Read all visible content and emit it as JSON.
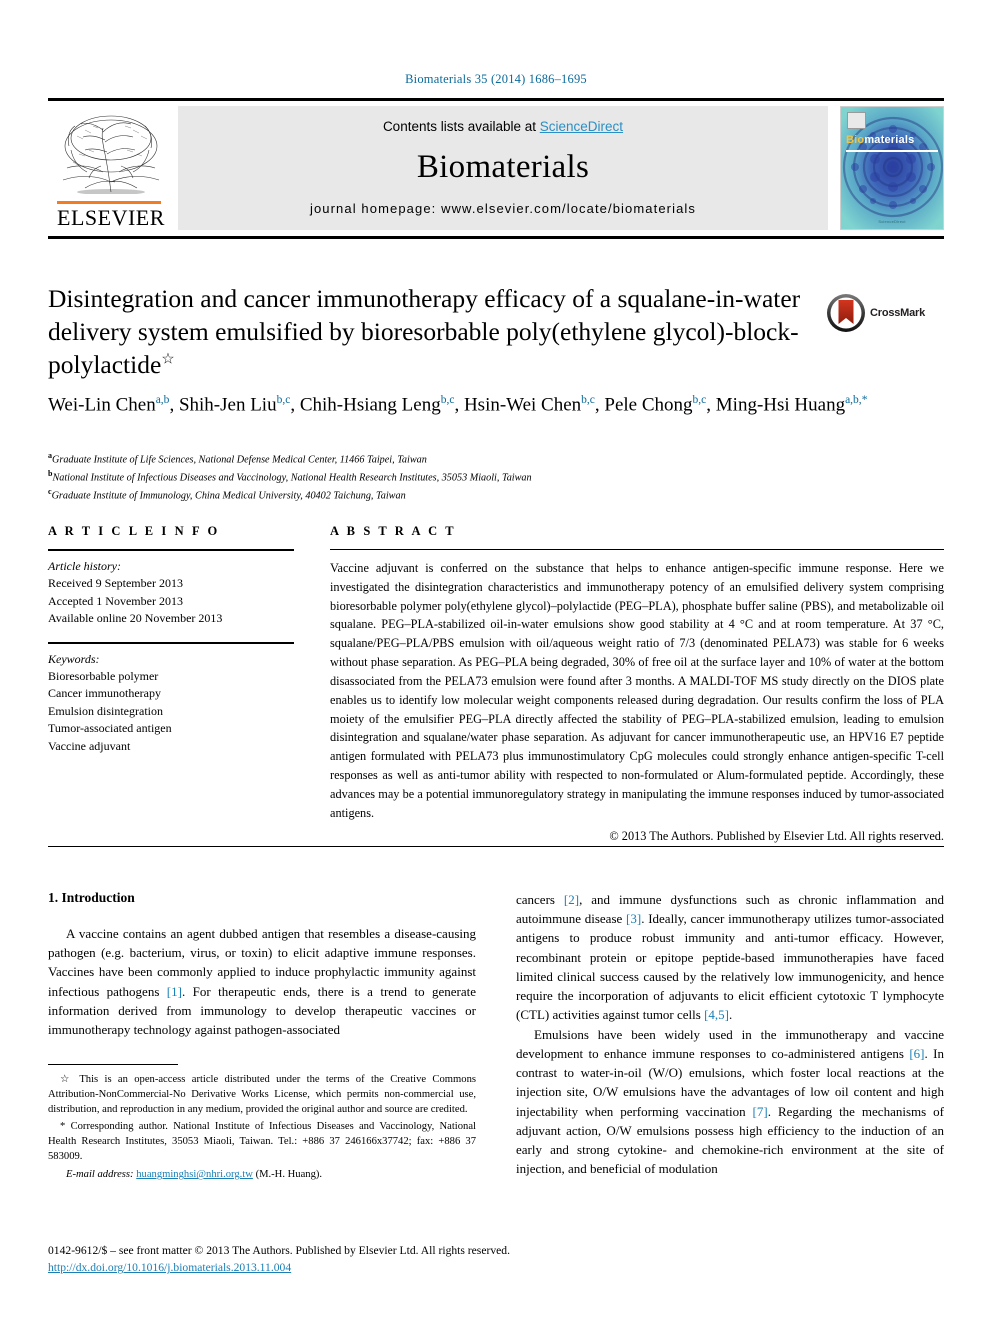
{
  "running_head": "Biomaterials 35 (2014) 1686–1695",
  "journal_header": {
    "contents_prefix": "Contents lists available at ",
    "sciencedirect": "ScienceDirect",
    "journal_title": "Biomaterials",
    "homepage": "journal homepage: www.elsevier.com/locate/biomaterials",
    "publisher": "ELSEVIER",
    "cover": {
      "title_bio": "Bio",
      "title_rest": "materials",
      "footer": "ScienceDirect"
    },
    "accent_orange": "#F47B20",
    "accent_blue": "#2a8fc4",
    "band_gray": "#e8e8e8",
    "cover_teal": "#5ec8c8"
  },
  "article": {
    "title": "Disintegration and cancer immunotherapy efficacy of a squalane-in-water delivery system emulsified by bioresorbable poly(ethylene glycol)-block-polylactide",
    "title_footnote_mark": "☆",
    "crossmark_label": "CrossMark",
    "authors_html": "Wei-Lin Chen<sup>a,b</sup>, Shih-Jen Liu<sup>b,c</sup>, Chih-Hsiang Leng<sup>b,c</sup>, Hsin-Wei Chen<sup>b,c</sup>, Pele Chong<sup>b,c</sup>, Ming-Hsi Huang<sup>a,b,</sup><sup>*</sup>",
    "affiliations": [
      {
        "mark": "a",
        "text": "Graduate Institute of Life Sciences, National Defense Medical Center, 11466 Taipei, Taiwan"
      },
      {
        "mark": "b",
        "text": "National Institute of Infectious Diseases and Vaccinology, National Health Research Institutes, 35053 Miaoli, Taiwan"
      },
      {
        "mark": "c",
        "text": "Graduate Institute of Immunology, China Medical University, 40402 Taichung, Taiwan"
      }
    ]
  },
  "article_info": {
    "heading": "A R T I C L E  I N F O",
    "history_label": "Article history:",
    "history": [
      "Received 9 September 2013",
      "Accepted 1 November 2013",
      "Available online 20 November 2013"
    ],
    "keywords_label": "Keywords:",
    "keywords": [
      "Bioresorbable polymer",
      "Cancer immunotherapy",
      "Emulsion disintegration",
      "Tumor-associated antigen",
      "Vaccine adjuvant"
    ]
  },
  "abstract": {
    "heading": "A B S T R A C T",
    "text": "Vaccine adjuvant is conferred on the substance that helps to enhance antigen-specific immune response. Here we investigated the disintegration characteristics and immunotherapy potency of an emulsified delivery system comprising bioresorbable polymer poly(ethylene glycol)–polylactide (PEG–PLA), phosphate buffer saline (PBS), and metabolizable oil squalane. PEG–PLA-stabilized oil-in-water emulsions show good stability at 4 °C and at room temperature. At 37 °C, squalane/PEG–PLA/PBS emulsion with oil/aqueous weight ratio of 7/3 (denominated PELA73) was stable for 6 weeks without phase separation. As PEG–PLA being degraded, 30% of free oil at the surface layer and 10% of water at the bottom disassociated from the PELA73 emulsion were found after 3 months. A MALDI-TOF MS study directly on the DIOS plate enables us to identify low molecular weight components released during degradation. Our results confirm the loss of PLA moiety of the emulsifier PEG–PLA directly affected the stability of PEG–PLA-stabilized emulsion, leading to emulsion disintegration and squalane/water phase separation. As adjuvant for cancer immunotherapeutic use, an HPV16 E7 peptide antigen formulated with PELA73 plus immunostimulatory CpG molecules could strongly enhance antigen-specific T-cell responses as well as anti-tumor ability with respected to non-formulated or Alum-formulated peptide. Accordingly, these advances may be a potential immunoregulatory strategy in manipulating the immune responses induced by tumor-associated antigens.",
    "copyright": "© 2013 The Authors. Published by Elsevier Ltd. All rights reserved."
  },
  "body": {
    "section_heading": "1. Introduction",
    "left_paragraph_1": "A vaccine contains an agent dubbed antigen that resembles a disease-causing pathogen (e.g. bacterium, virus, or toxin) to elicit adaptive immune responses. Vaccines have been commonly applied to induce prophylactic immunity against infectious pathogens",
    "left_ref_1": "[1]",
    "left_paragraph_1b": ". For therapeutic ends, there is a trend to generate information derived from immunology to develop therapeutic vaccines or immunotherapy technology against pathogen-associated",
    "right_paragraph_1_pre": "cancers ",
    "right_ref_2": "[2]",
    "right_paragraph_1_mid": ", and immune dysfunctions such as chronic inflammation and autoimmune disease ",
    "right_ref_3": "[3]",
    "right_paragraph_1_post": ". Ideally, cancer immunotherapy utilizes tumor-associated antigens to produce robust immunity and anti-tumor efficacy. However, recombinant protein or epitope peptide-based immunotherapies have faced limited clinical success caused by the relatively low immunogenicity, and hence require the incorporation of adjuvants to elicit efficient cytotoxic T lymphocyte (CTL) activities against tumor cells ",
    "right_ref_45": "[4,5]",
    "right_paragraph_1_end": ".",
    "right_paragraph_2_pre": "Emulsions have been widely used in the immunotherapy and vaccine development to enhance immune responses to co-administered antigens ",
    "right_ref_6": "[6]",
    "right_paragraph_2_mid": ". In contrast to water-in-oil (W/O) emulsions, which foster local reactions at the injection site, O/W emulsions have the advantages of low oil content and high injectability when performing vaccination ",
    "right_ref_7": "[7]",
    "right_paragraph_2_post": ". Regarding the mechanisms of adjuvant action, O/W emulsions possess high efficiency to the induction of an early and strong cytokine- and chemokine-rich environment at the site of injection, and beneficial of modulation"
  },
  "footnotes": {
    "open_access_mark": "☆",
    "open_access": " This is an open-access article distributed under the terms of the Creative Commons Attribution-NonCommercial-No Derivative Works License, which permits non-commercial use, distribution, and reproduction in any medium, provided the original author and source are credited.",
    "corresponding_mark": "*",
    "corresponding": " Corresponding author. National Institute of Infectious Diseases and Vaccinology, National Health Research Institutes, 35053 Miaoli, Taiwan. Tel.: +886 37 246166x37742; fax: +886 37 583009.",
    "email_label": "E-mail address:",
    "email": "huangminghsi@nhri.org.tw",
    "email_suffix": "(M.-H. Huang)."
  },
  "page_footer": {
    "issn_line": "0142-9612/$ – see front matter © 2013 The Authors. Published by Elsevier Ltd. All rights reserved.",
    "doi": "http://dx.doi.org/10.1016/j.biomaterials.2013.11.004"
  }
}
